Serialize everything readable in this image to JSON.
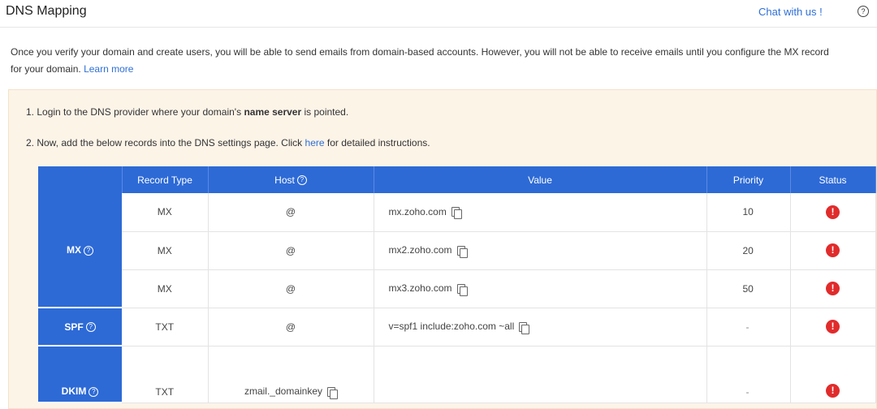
{
  "header": {
    "title": "DNS Mapping",
    "chat_label": "Chat with us !",
    "help_label": "?"
  },
  "intro": {
    "line1": "Once you verify your domain and create users, you will be able to send emails from domain-based accounts. However, you will not be able to receive emails until you configure the MX record",
    "line2": "for your domain.",
    "learn_more": "Learn more"
  },
  "steps": {
    "step1_pre": "1. Login to the DNS provider where your domain's ",
    "step1_bold": "name server",
    "step1_post": " is pointed.",
    "step2_pre": "2. Now, add the below records into the DNS settings page. Click ",
    "step2_link": "here",
    "step2_post": " for detailed instructions."
  },
  "table": {
    "columns": {
      "record_type": "Record Type",
      "host": "Host",
      "value": "Value",
      "priority": "Priority",
      "status": "Status"
    },
    "groups": {
      "mx": "MX",
      "spf": "SPF",
      "dkim": "DKIM"
    },
    "rows": [
      {
        "type": "MX",
        "host": "@",
        "value": "mx.zoho.com",
        "priority": "10"
      },
      {
        "type": "MX",
        "host": "@",
        "value": "mx2.zoho.com",
        "priority": "20"
      },
      {
        "type": "MX",
        "host": "@",
        "value": "mx3.zoho.com",
        "priority": "50"
      },
      {
        "type": "TXT",
        "host": "@",
        "value": "v=spf1 include:zoho.com ~all",
        "priority": "-"
      },
      {
        "type": "TXT",
        "host": "zmail._domainkey",
        "value": "",
        "priority": "-"
      }
    ],
    "status_symbol": "!"
  },
  "colors": {
    "table_header": "#2d6ad6",
    "link": "#2f6fd6",
    "panel_bg": "#fdf4e8",
    "error": "#e12b2b"
  },
  "icons": {
    "copy": "copy-icon",
    "status": "error-icon",
    "help": "help-icon"
  }
}
